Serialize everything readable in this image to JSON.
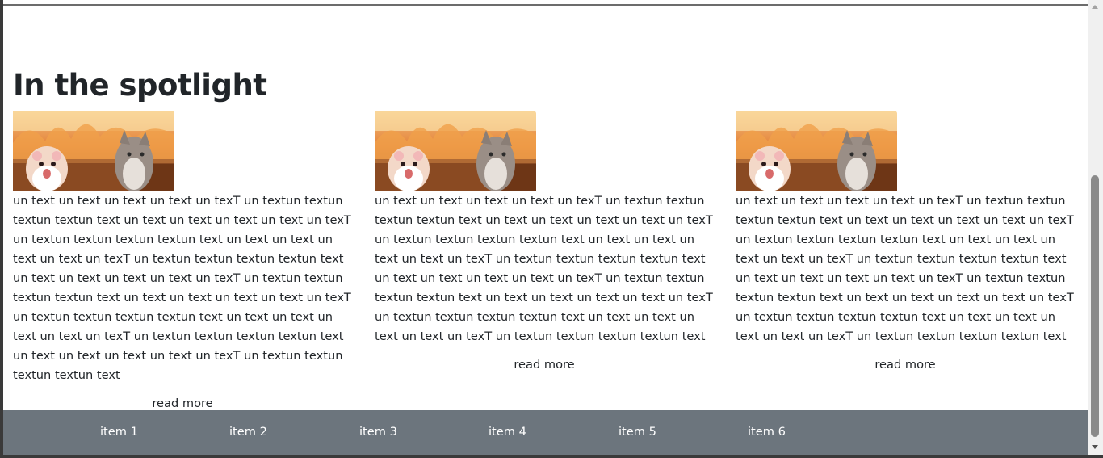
{
  "section": {
    "title": "In the spotlight"
  },
  "cards": [
    {
      "image": "hamster-cat-fire-image",
      "text": "un text un text un text un text un texT un textun textun textun textun text un text un text un text un text un texT un textun textun textun textun text un text un text un text un text un texT un textun textun textun textun text un text un text un text un text un texT un textun textun textun textun text un text un text un text un text un texT un textun textun textun textun text un text un text un text un text un texT un textun textun textun textun text un text un text un text un text un texT un textun textun textun textun text",
      "read_more": "read more"
    },
    {
      "image": "hamster-cat-fire-image",
      "text": "un text un text un text un text un texT un textun textun textun textun text un text un text un text un text un texT un textun textun textun textun text un text un text un text un text un texT un textun textun textun textun text un text un text un text un text un texT un textun textun textun textun text un text un text un text un text un texT un textun textun textun textun text un text un text un text un text un texT un textun textun textun textun text",
      "read_more": "read more"
    },
    {
      "image": "hamster-cat-fire-image",
      "text": "un text un text un text un text un texT un textun textun textun textun text un text un text un text un text un texT un textun textun textun textun text un text un text un text un text un texT un textun textun textun textun text un text un text un text un text un texT un textun textun textun textun text un text un text un text un text un texT un textun textun textun textun text un text un text un text un text un texT un textun textun textun textun text",
      "read_more": "read more"
    }
  ],
  "footer": {
    "items": [
      "item 1",
      "item 2",
      "item 3",
      "item 4",
      "item 5",
      "item 6"
    ],
    "background": "#6c757d"
  }
}
